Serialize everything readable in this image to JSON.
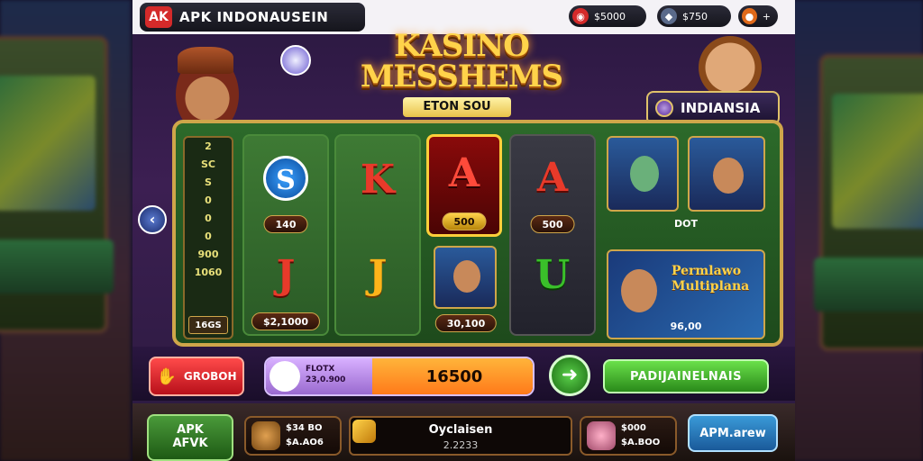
{
  "app": {
    "brand_logo": "AK",
    "brand_title": "APK INDONAUSEIN"
  },
  "topbar": {
    "coins": "$5000",
    "gems": "$750",
    "lives_icon": "plus"
  },
  "banner": {
    "title_line1": "KASINO",
    "title_line2": "MESSHEMS",
    "subtitle": "ETON SOU"
  },
  "region": {
    "label": "INDIANSIA"
  },
  "paytable": {
    "values": [
      "2",
      "SC",
      "S",
      "0",
      "0",
      "0",
      "900",
      "1060"
    ],
    "bottom": "16GS"
  },
  "reels": [
    {
      "top_symbol": "S",
      "label": "140",
      "bottom_symbol": "J",
      "bottom_label": "$2,1000"
    },
    {
      "top_symbol": "K",
      "bottom_symbol": "J"
    },
    {
      "top_symbol": "A",
      "label": "500",
      "bottom_label": "30,100"
    },
    {
      "top_symbol": "A",
      "label": "500",
      "bottom_symbol": "U"
    }
  ],
  "side_panel": {
    "top_label": "DOT",
    "promo_text": "Permlawo Multiplana",
    "promo_value": "96,00"
  },
  "controls": {
    "red_button": "GROBOH",
    "bet_label_1": "FLOTX",
    "bet_label_2": "23,0.900",
    "bet_amount": "16500",
    "spin_icon": "arrow-right",
    "green_button": "PADIJAINELNAIS"
  },
  "bottom": {
    "apk_line1": "APK",
    "apk_line2": "AFVK",
    "card1_line1": "$34 BO",
    "card1_line2": "$A.AO6",
    "mid_title": "Oyclaisen",
    "mid_sub": "2.2233",
    "card2_line1": "$000",
    "card2_line2": "$A.BOO",
    "blue_button": "APM.arew"
  },
  "colors": {
    "accent_gold": "#ffd34a",
    "reel_green": "#3e7a34",
    "button_red": "#d42a2a",
    "button_green": "#4ab02a",
    "button_blue": "#2a7ac0"
  }
}
